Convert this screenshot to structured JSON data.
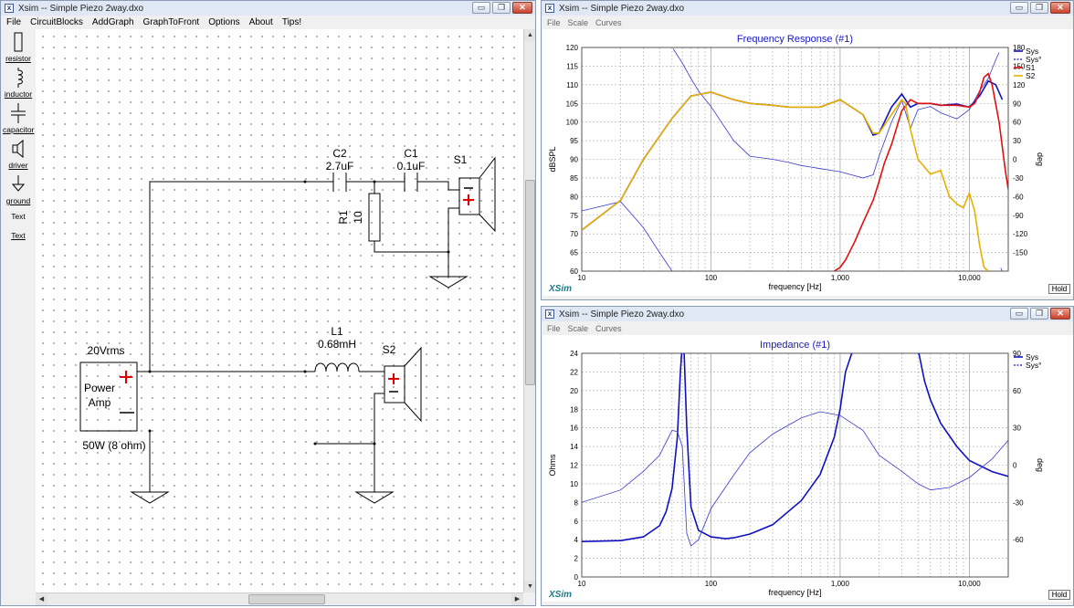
{
  "left_window": {
    "title": "Xsim -- Simple Piezo 2way.dxo",
    "menu": [
      "File",
      "CircuitBlocks",
      "AddGraph",
      "GraphToFront",
      "Options",
      "About",
      "Tips!"
    ],
    "toolbox": [
      "resistor",
      "inductor",
      "capacitor",
      "driver",
      "ground",
      "Text",
      "Text"
    ],
    "schematic": {
      "amp_voltage": "20Vrms",
      "amp_label_1": "Power",
      "amp_label_2": "Amp",
      "amp_power": "50W (8 ohm)",
      "c2_name": "C2",
      "c2_value": "2.7uF",
      "c1_name": "C1",
      "c1_value": "0.1uF",
      "r1_name": "R1",
      "r1_value": "10",
      "s1_name": "S1",
      "l1_name": "L1",
      "l1_value": "0.68mH",
      "s2_name": "S2"
    }
  },
  "fr_window": {
    "title": "Xsim -- Simple Piezo 2way.dxo",
    "menu": [
      "File",
      "Scale",
      "Curves"
    ],
    "logo": "XSim",
    "hold": "Hold"
  },
  "imp_window": {
    "title": "Xsim -- Simple Piezo 2way.dxo",
    "menu": [
      "File",
      "Scale",
      "Curves"
    ],
    "logo": "XSim",
    "hold": "Hold"
  },
  "window_buttons": {
    "minimize": "▭",
    "restore": "❐",
    "close": "✕"
  },
  "chart_data": [
    {
      "type": "line",
      "title": "Frequency Response (#1)",
      "xlabel": "frequency [Hz]",
      "ylabel": "dBSPL",
      "y2label": "deg",
      "xscale": "log",
      "xlim": [
        10,
        20000
      ],
      "ylim": [
        60,
        120
      ],
      "y2lim": [
        -180,
        180
      ],
      "x_ticks": [
        "10",
        "100",
        "1,000",
        "10,000"
      ],
      "y_ticks": [
        "120",
        "115",
        "110",
        "105",
        "100",
        "95",
        "90",
        "85",
        "80",
        "75",
        "70",
        "65",
        "60"
      ],
      "y2_ticks": [
        "180",
        "150",
        "120",
        "90",
        "60",
        "30",
        "0",
        "-30",
        "-60",
        "-90",
        "-120",
        "-150"
      ],
      "legend": [
        "Sys",
        "Sys°",
        "S1",
        "S2"
      ],
      "legend_position": "right",
      "colors": {
        "Sys": "#1010c0",
        "Sys°": "#3a3ad0",
        "S1": "#e01010",
        "S2": "#e8b000"
      },
      "series": [
        {
          "name": "Sys",
          "axis": "left",
          "x": [
            10,
            20,
            30,
            50,
            70,
            100,
            150,
            200,
            300,
            400,
            500,
            700,
            1000,
            1500,
            1800,
            2000,
            2200,
            2500,
            3000,
            3500,
            4000,
            5000,
            6000,
            8000,
            10000,
            12000,
            14000,
            16000,
            18000
          ],
          "y": [
            71,
            79,
            90,
            101,
            107,
            108,
            106,
            105,
            104.5,
            104,
            104,
            104,
            106,
            102,
            96.5,
            97,
            100,
            104,
            107.5,
            104,
            105,
            105,
            104.5,
            104.8,
            104,
            107,
            111,
            110,
            106
          ]
        },
        {
          "name": "Sys°",
          "axis": "right",
          "x": [
            10,
            20,
            30,
            40,
            50,
            51,
            60,
            70,
            80,
            100,
            150,
            200,
            300,
            400,
            500,
            700,
            1000,
            1500,
            1800,
            2000,
            2500,
            3000,
            3500,
            4000,
            5000,
            6000,
            8000,
            10000,
            12000,
            14000,
            16000,
            17000,
            17500,
            18000
          ],
          "y": [
            -83,
            -68,
            -110,
            -150,
            -180,
            178,
            155,
            130,
            110,
            85,
            30,
            5,
            0,
            -5,
            -10,
            -15,
            -20,
            -30,
            -25,
            5,
            60,
            95,
            50,
            80,
            85,
            75,
            65,
            80,
            110,
            130,
            160,
            172,
            -175,
            -180
          ]
        },
        {
          "name": "S1",
          "axis": "left",
          "x": [
            900,
            1000,
            1100,
            1300,
            1500,
            1800,
            2000,
            2200,
            2500,
            3000,
            3500,
            4000,
            5000,
            6000,
            8000,
            10000,
            11000,
            12000,
            13000,
            14000,
            15000,
            17000,
            19000,
            20000
          ],
          "y": [
            60,
            61,
            63,
            68,
            73,
            79,
            84,
            89,
            94,
            103,
            106,
            105,
            105,
            104.5,
            104.5,
            104,
            105,
            108,
            112,
            113,
            110,
            100,
            87,
            82
          ]
        },
        {
          "name": "S2",
          "axis": "left",
          "x": [
            10,
            20,
            30,
            50,
            70,
            100,
            150,
            200,
            300,
            400,
            500,
            700,
            1000,
            1500,
            1800,
            2000,
            2500,
            3000,
            3200,
            3500,
            4000,
            5000,
            6000,
            7000,
            8000,
            9000,
            10000,
            11000,
            12000,
            13000,
            14000
          ],
          "y": [
            71,
            79,
            90,
            101,
            107,
            108,
            106,
            105,
            104.5,
            104,
            104,
            104,
            106,
            102,
            97,
            97,
            102,
            106,
            105,
            98,
            90,
            86,
            87,
            80,
            78,
            77,
            81,
            76,
            67,
            61,
            60
          ]
        }
      ]
    },
    {
      "type": "line",
      "title": "Impedance (#1)",
      "xlabel": "frequency [Hz]",
      "ylabel": "Ohms",
      "y2label": "deg",
      "xscale": "log",
      "xlim": [
        10,
        20000
      ],
      "ylim": [
        0,
        24
      ],
      "y2lim": [
        -90,
        90
      ],
      "x_ticks": [
        "10",
        "100",
        "1,000",
        "10,000"
      ],
      "y_ticks": [
        "24",
        "22",
        "20",
        "18",
        "16",
        "14",
        "12",
        "10",
        "8",
        "6",
        "4",
        "2",
        "0"
      ],
      "y2_ticks": [
        "90",
        "60",
        "30",
        "0",
        "-30",
        "-60"
      ],
      "legend": [
        "Sys",
        "Sys°"
      ],
      "legend_position": "right",
      "colors": {
        "Sys": "#1010c0",
        "Sys°": "#3a3ad0"
      },
      "series": [
        {
          "name": "Sys",
          "axis": "left",
          "x": [
            10,
            20,
            30,
            40,
            45,
            50,
            55,
            58,
            60,
            62,
            65,
            70,
            80,
            100,
            130,
            150,
            200,
            300,
            500,
            700,
            900,
            1000,
            1100,
            1300,
            1600,
            2000,
            3000,
            3500,
            3800,
            4000,
            4500,
            5000,
            6000,
            8000,
            10000,
            15000,
            20000
          ],
          "y": [
            3.8,
            3.9,
            4.3,
            5.5,
            7,
            9.5,
            15,
            22,
            25,
            24,
            16,
            7.5,
            5,
            4.3,
            4.1,
            4.2,
            4.6,
            5.6,
            8.2,
            11,
            15,
            18,
            22,
            25,
            25,
            25,
            25,
            25,
            25,
            24.5,
            21,
            19,
            16.5,
            14,
            12.5,
            11.3,
            10.8
          ]
        },
        {
          "name": "Sys°",
          "axis": "right",
          "x": [
            10,
            20,
            30,
            40,
            50,
            55,
            60,
            65,
            70,
            80,
            100,
            150,
            200,
            300,
            500,
            700,
            1000,
            1500,
            2000,
            3000,
            4000,
            5000,
            7000,
            10000,
            15000,
            20000
          ],
          "y": [
            -30,
            -20,
            -5,
            8,
            28,
            27,
            15,
            -55,
            -65,
            -60,
            -35,
            -8,
            10,
            25,
            38,
            43,
            40,
            28,
            8,
            -5,
            -15,
            -20,
            -18,
            -10,
            5,
            20
          ]
        }
      ]
    }
  ]
}
